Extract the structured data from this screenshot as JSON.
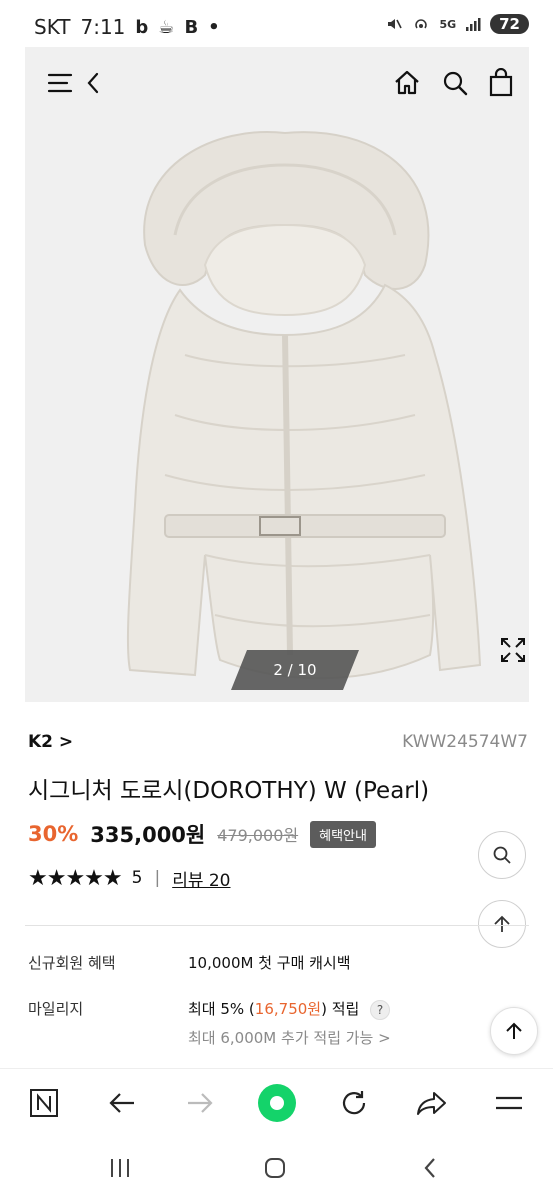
{
  "status_bar": {
    "carrier": "SKT",
    "time": "7:11",
    "app_icons": [
      "b",
      "☕",
      "B",
      "•"
    ],
    "network": "5G",
    "battery": "72"
  },
  "hero": {
    "image_counter": "2 / 10",
    "icons": [
      "menu-icon",
      "back-icon",
      "home-icon",
      "search-icon",
      "shopping-bag-icon",
      "expand-icon"
    ]
  },
  "product": {
    "brand": "K2 >",
    "code": "KWW24574W7",
    "title": "시그니처 도로시(DOROTHY) W (Pearl)",
    "discount": "30%",
    "price": "335,000원",
    "original_price": "479,000원",
    "benefit_button": "혜택안내",
    "stars": "★★★★★",
    "rating": "5",
    "separator": "|",
    "reviews": "리뷰 20"
  },
  "benefits": {
    "new_member_label": "신규회원 혜택",
    "new_member_value": "10,000M 첫 구매 캐시백",
    "mileage_label": "마일리지",
    "mileage_prefix": "최대 5% (",
    "mileage_amount": "16,750원",
    "mileage_suffix": ") 적립",
    "help": "?",
    "mileage_extra": "최대 6,000M 추가 적립 가능 >"
  },
  "colors": {
    "accent": "#e8652f",
    "hero_bg": "#f0f0f0",
    "browser_green": "#14d36a"
  }
}
